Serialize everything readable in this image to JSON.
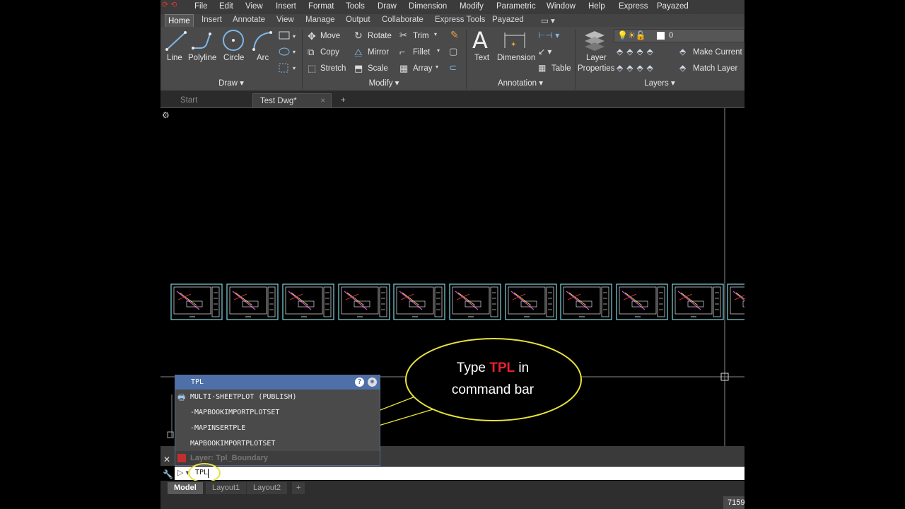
{
  "menubar": {
    "quick_access": "⟳ ⟲",
    "items": [
      "File",
      "Edit",
      "View",
      "Insert",
      "Format",
      "Tools",
      "Draw",
      "Dimension",
      "Modify",
      "Parametric",
      "Window",
      "Help",
      "Express",
      "Payazed"
    ]
  },
  "ribbon_tabs": [
    "Home",
    "Insert",
    "Annotate",
    "View",
    "Manage",
    "Output",
    "Collaborate",
    "Express Tools",
    "Payazed"
  ],
  "ribbon_extra": "▭ ▾",
  "draw_panel": {
    "title": "Draw ▾",
    "line": "Line",
    "polyline": "Polyline",
    "circle": "Circle",
    "arc": "Arc"
  },
  "modify_panel": {
    "title": "Modify ▾",
    "move": "Move",
    "rotate": "Rotate",
    "trim": "Trim",
    "copy": "Copy",
    "mirror": "Mirror",
    "fillet": "Fillet",
    "stretch": "Stretch",
    "scale": "Scale",
    "array": "Array"
  },
  "annotation_panel": {
    "title": "Annotation ▾",
    "text": "Text",
    "dimension": "Dimension",
    "table": "Table"
  },
  "layers_panel": {
    "title": "Layers ▾",
    "layer_properties_1": "Layer",
    "layer_properties_2": "Properties",
    "layer_value": "0",
    "make_current": "Make Current",
    "match_layer": "Match Layer"
  },
  "doc_tabs": {
    "start": "Start",
    "active": "Test Dwg*",
    "close": "×",
    "add": "+"
  },
  "autocomplete": {
    "header": "TPL",
    "items": [
      "MULTI-SHEETPLOT (PUBLISH)",
      "-MAPBOOKIMPORTPLOTSET",
      "-MAPINSERTPLE",
      "MAPBOOKIMPORTPLOTSET"
    ]
  },
  "status_hint": "Layer: Tpl_Boundary",
  "command_input": "TPL",
  "layout_tabs": [
    "Model",
    "Layout1",
    "Layout2",
    "+"
  ],
  "coordinates": "7159",
  "callout": {
    "prefix": "Type ",
    "highlight": "TPL",
    "suffix": " in",
    "line2": "command bar"
  },
  "colors": {
    "highlight": "#e8202a",
    "callout_border": "#e8e23c",
    "frame": "#7fd6e0",
    "popup_header": "#4f6fa8"
  }
}
